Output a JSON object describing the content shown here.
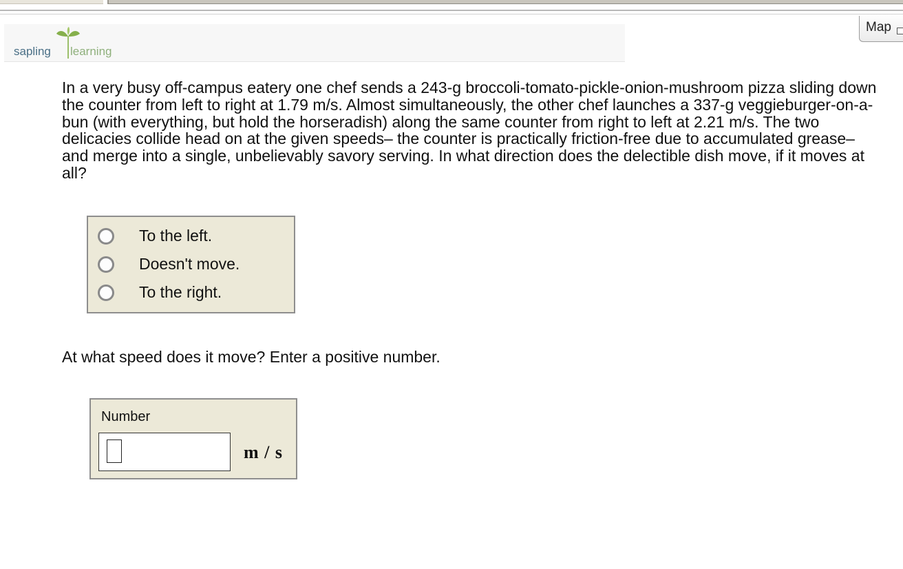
{
  "header": {
    "logo_word1": "sapling",
    "logo_word2": "learning"
  },
  "map_button": {
    "label": "Map"
  },
  "question": {
    "text": "In a very busy off-campus eatery one chef sends a 243-g broccoli-tomato-pickle-onion-mushroom pizza sliding down the counter from left to right at 1.79 m/s. Almost simultaneously, the other chef launches a 337-g veggieburger-on-a-bun (with everything, but hold the horseradish) along the same counter from right to left at 2.21 m/s. The two delicacies collide head on at the given speeds– the counter is practically friction-free due to accumulated grease– and merge into a single, unbelievably savory serving. In what direction does the delectible dish move, if it moves at all?"
  },
  "choices": [
    {
      "label": "To the left.",
      "selected": false
    },
    {
      "label": "Doesn't move.",
      "selected": false
    },
    {
      "label": "To the right.",
      "selected": false
    }
  ],
  "speed_prompt": "At what speed does it move? Enter a positive number.",
  "number_answer": {
    "title": "Number",
    "value": "",
    "unit": "m / s"
  },
  "colors": {
    "panel_bg": "#ece9d8",
    "logo_blue": "#4a6f86",
    "logo_green": "#8fb07c"
  }
}
